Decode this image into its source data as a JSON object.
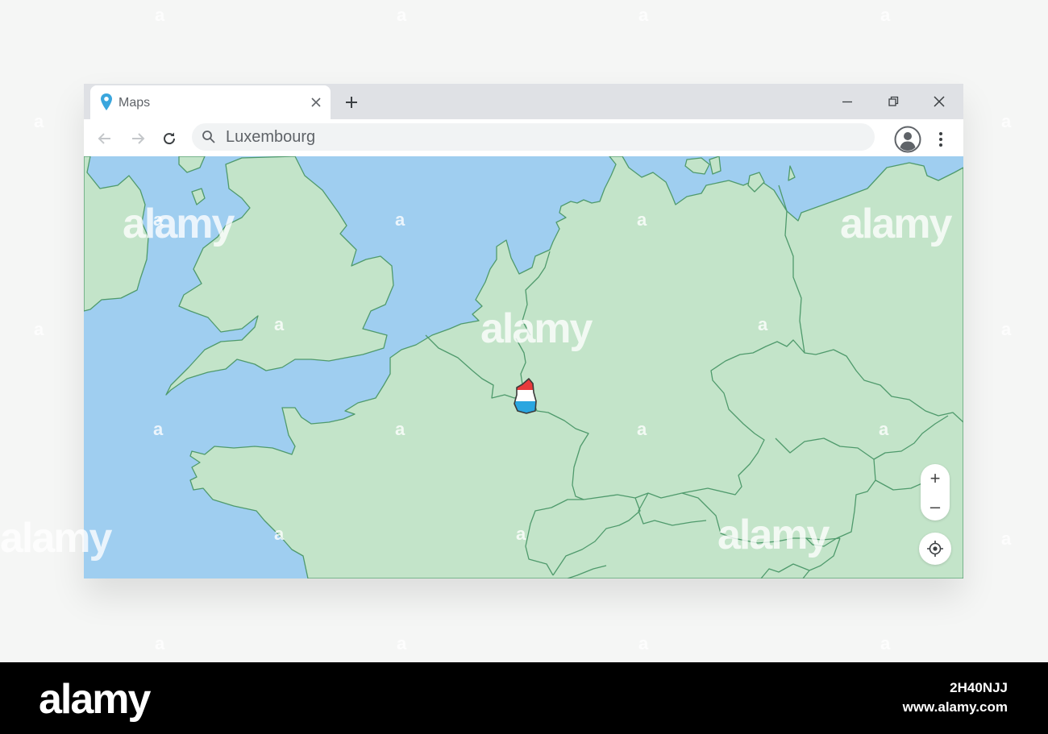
{
  "browser": {
    "tab": {
      "title": "Maps",
      "icon": "map-pin-icon",
      "close_icon": "close-icon"
    },
    "new_tab_icon": "plus-icon",
    "window_controls": [
      "minimize-icon",
      "restore-icon",
      "close-icon"
    ],
    "nav": {
      "back_icon": "arrow-left-icon",
      "forward_icon": "arrow-right-icon",
      "reload_icon": "reload-icon"
    },
    "address_bar": {
      "value": "Luxembourg",
      "search_icon": "search-icon"
    },
    "profile_icon": "account-circle-icon",
    "menu_icon": "more-vertical-icon"
  },
  "map": {
    "highlighted_country": "Luxembourg",
    "marker": "luxembourg-flag-marker",
    "zoom_in_label": "+",
    "zoom_out_label": "–",
    "locate_icon": "crosshair-icon",
    "colors": {
      "water": "#9fcef0",
      "land": "#c3e4c9",
      "border": "#4f9a6c"
    }
  },
  "watermark": {
    "text": "alamy",
    "glyph": "a"
  },
  "footer": {
    "logo": "alamy",
    "image_id": "2H40NJJ",
    "url": "www.alamy.com"
  }
}
